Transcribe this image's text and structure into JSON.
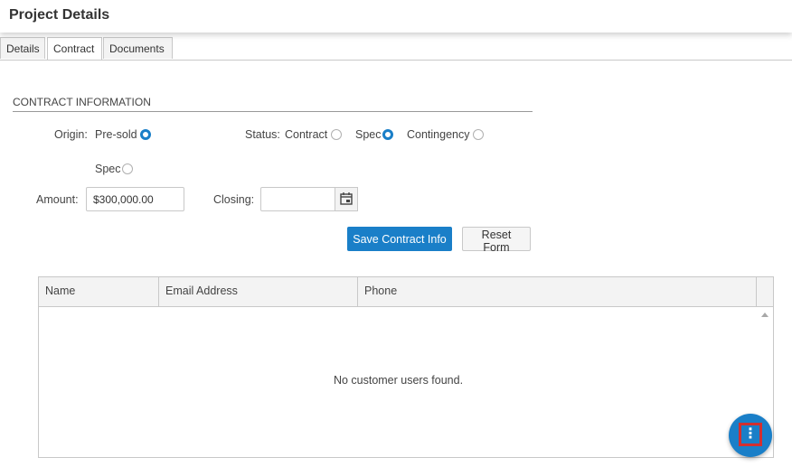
{
  "header": {
    "title": "Project Details"
  },
  "tabs": [
    {
      "label": "Details",
      "active": false
    },
    {
      "label": "Contract",
      "active": true
    },
    {
      "label": "Documents",
      "active": false
    }
  ],
  "contract": {
    "section_title": "CONTRACT INFORMATION",
    "origin": {
      "label": "Origin:",
      "options": [
        {
          "label": "Pre-sold",
          "selected": true
        },
        {
          "label": "Spec",
          "selected": false
        }
      ]
    },
    "status": {
      "label": "Status:",
      "options": [
        {
          "label": "Contract",
          "selected": false
        },
        {
          "label": "Spec",
          "selected": true
        },
        {
          "label": "Contingency",
          "selected": false
        }
      ]
    },
    "amount": {
      "label": "Amount:",
      "value": "$300,000.00"
    },
    "closing": {
      "label": "Closing:",
      "value": "",
      "icon": "calendar-icon"
    },
    "save_label": "Save Contract Info",
    "reset_label": "Reset Form"
  },
  "customers_grid": {
    "columns": [
      "Name",
      "Email Address",
      "Phone"
    ],
    "rows": [],
    "empty_message": "No customer users found."
  },
  "fab": {
    "icon": "more-vertical-icon",
    "glyph": "⋮",
    "highlight_color": "#d32f2f"
  },
  "colors": {
    "accent": "#1a7fc8",
    "highlight": "#d32f2f"
  }
}
